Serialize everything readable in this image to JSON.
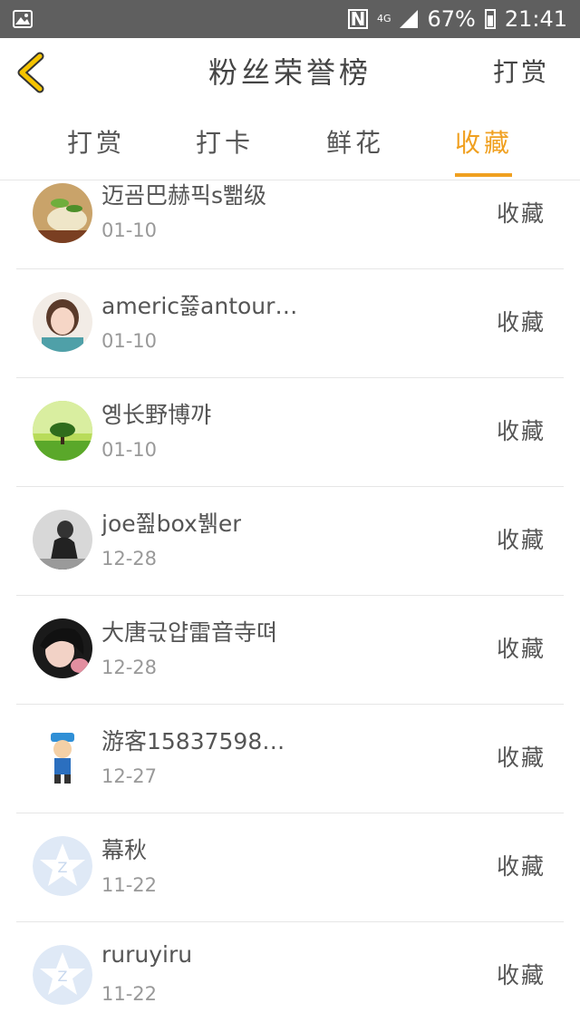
{
  "status": {
    "network": "4G",
    "battery": "67%",
    "time": "21:41"
  },
  "header": {
    "title": "粉丝荣誉榜",
    "action_label": "打赏"
  },
  "tabs": [
    {
      "label": "打赏"
    },
    {
      "label": "打卡"
    },
    {
      "label": "鲜花"
    },
    {
      "label": "收藏"
    }
  ],
  "active_tab": "收藏",
  "list": [
    {
      "name": "迈굠巴赫픽s뾂级",
      "date": "01-10",
      "action": "收藏",
      "avatar": "food-photo"
    },
    {
      "name": "americ쯣antour…",
      "date": "01-10",
      "action": "收藏",
      "avatar": "girl-photo"
    },
    {
      "name": "옝长野博꺄",
      "date": "01-10",
      "action": "收藏",
      "avatar": "tree-photo"
    },
    {
      "name": "joe쬞box뷁er",
      "date": "12-28",
      "action": "收藏",
      "avatar": "bw-photo"
    },
    {
      "name": "大唐귻얍雷音寺뗘",
      "date": "12-28",
      "action": "收藏",
      "avatar": "selfie-photo"
    },
    {
      "name": "游客15837598…",
      "date": "12-27",
      "action": "收藏",
      "avatar": "cartoon-avatar"
    },
    {
      "name": "幕秋",
      "date": "11-22",
      "action": "收藏",
      "avatar": "default-avatar"
    },
    {
      "name": "ruruyiru",
      "date": "11-22",
      "action": "收藏",
      "avatar": "default-avatar"
    }
  ]
}
